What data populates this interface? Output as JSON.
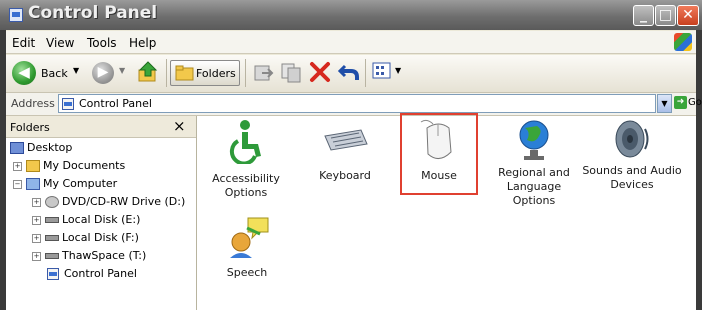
{
  "window": {
    "title": "Control Panel"
  },
  "menu": [
    "Edit",
    "View",
    "Tools",
    "Help"
  ],
  "toolbar": {
    "back_label": "Back",
    "folders_label": "Folders"
  },
  "address": {
    "label": "Address",
    "value": "Control Panel",
    "go_label": "Go"
  },
  "folders_pane": {
    "title": "Folders",
    "close": "×",
    "tree": [
      {
        "label": "Desktop"
      },
      {
        "label": "My Documents",
        "expander": "+"
      },
      {
        "label": "My Computer",
        "expander": "−"
      },
      {
        "label": "DVD/CD-RW Drive (D:)",
        "expander": "+"
      },
      {
        "label": "Local Disk (E:)",
        "expander": "+"
      },
      {
        "label": "Local Disk (F:)",
        "expander": "+"
      },
      {
        "label": "ThawSpace (T:)",
        "expander": "+"
      },
      {
        "label": "Control Panel"
      }
    ]
  },
  "items": [
    {
      "line1": "Accessibility",
      "line2": "Options",
      "icon": "accessibility-icon"
    },
    {
      "line1": "Keyboard",
      "line2": "",
      "icon": "keyboard-icon"
    },
    {
      "line1": "Mouse",
      "line2": "",
      "icon": "mouse-icon"
    },
    {
      "line1": "Regional and",
      "line2": "Language Options",
      "icon": "globe-icon"
    },
    {
      "line1": "Sounds and Audio",
      "line2": "Devices",
      "icon": "speaker-icon"
    },
    {
      "line1": "Speech",
      "line2": "",
      "icon": "speech-icon"
    }
  ]
}
